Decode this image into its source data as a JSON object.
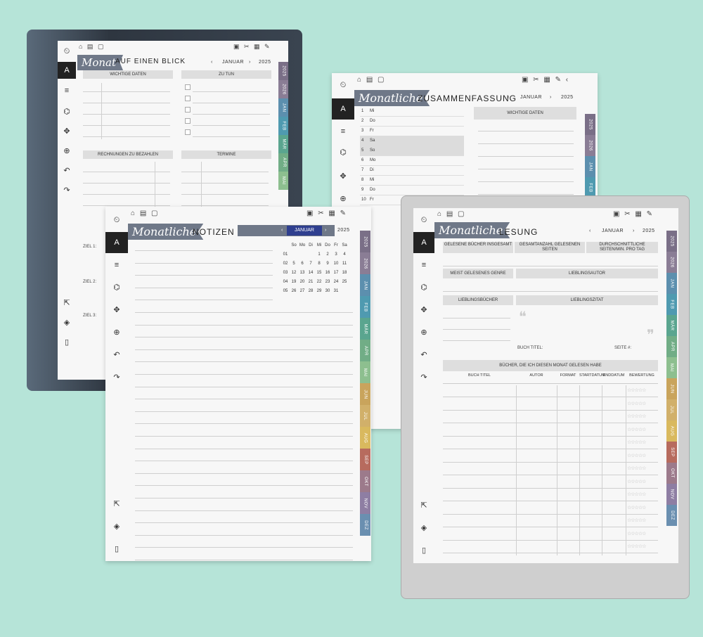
{
  "icons": {
    "home": "home-icon",
    "doc": "doc-icon",
    "page": "page-icon",
    "cal": "calendar-icon",
    "shuf": "shuffle-icon",
    "grid": "grid-icon",
    "clip": "clip-icon"
  },
  "toolbar": {
    "g1": "⏲",
    "g2": "A",
    "g3": "≡",
    "g4": "⌬",
    "g5": "✥",
    "g6": "⊕",
    "g7": "↶",
    "g8": "↷",
    "g9": "⇱",
    "g10": "◈",
    "g11": "▯"
  },
  "dev1": {
    "banner": "Monat",
    "title": "AUF EINEN BLICK",
    "month": "JANUAR",
    "year": "2025",
    "h1": "WICHTIGE DATEN",
    "h2": "ZU TUN",
    "h3": "RECHNUNGEN ZU BEZAHLEN",
    "h4": "TERMINE",
    "z1": "ZIEL 1:",
    "z2": "ZIEL 2:",
    "z3": "ZIEL 3:",
    "tabs": [
      "2025",
      "2026",
      "JAN",
      "FEB",
      "MÄR",
      "APR",
      "MAI"
    ]
  },
  "dev2": {
    "banner": "Monatliche",
    "title": "ZUSAMMENFASSUNG",
    "month": "JANUAR",
    "year": "2025",
    "hdr": "WICHTIGE DATEN",
    "days": [
      [
        "1",
        "Mi"
      ],
      [
        "2",
        "Do"
      ],
      [
        "3",
        "Fr"
      ],
      [
        "4",
        "Sa"
      ],
      [
        "5",
        "So"
      ],
      [
        "6",
        "Mo"
      ],
      [
        "7",
        "Di"
      ],
      [
        "8",
        "Mi"
      ],
      [
        "9",
        "Do"
      ],
      [
        "10",
        "Fr"
      ]
    ],
    "tabs": [
      "2025",
      "2026",
      "JAN",
      "FEB"
    ]
  },
  "dev3": {
    "banner": "Monatliche",
    "title": "NOTIZEN",
    "month": "JANUAR",
    "year": "2025",
    "wd": [
      "",
      "So",
      "Mo",
      "Di",
      "Mi",
      "Do",
      "Fr",
      "Sa"
    ],
    "weeks": [
      [
        "01",
        "",
        "",
        "",
        "1",
        "2",
        "3",
        "4"
      ],
      [
        "02",
        "5",
        "6",
        "7",
        "8",
        "9",
        "10",
        "11"
      ],
      [
        "03",
        "12",
        "13",
        "14",
        "15",
        "16",
        "17",
        "18"
      ],
      [
        "04",
        "19",
        "20",
        "21",
        "22",
        "23",
        "24",
        "25"
      ],
      [
        "05",
        "26",
        "27",
        "28",
        "29",
        "30",
        "31",
        ""
      ]
    ],
    "tabs": [
      "2025",
      "2026",
      "JAN",
      "FEB",
      "MÄR",
      "APR",
      "MAI",
      "JUN",
      "JUL",
      "AUG",
      "SEP",
      "OKT",
      "NOV",
      "DEZ"
    ]
  },
  "dev4": {
    "banner": "Monatliche",
    "title": "LESUNG",
    "month": "JANUAR",
    "year": "2025",
    "s1": "GELESENE BÜCHER INSGESAMT",
    "s2": "GESAMTANZAHL GELESENEN SEITEN",
    "s3": "DURCHSCHNITTLICHE SEITEN/MIN. PRO TAG",
    "genre": "MEIST GELESENES GENRE",
    "autor": "LIEBLINGSAUTOR",
    "books": "LIEBLINGSBÜCHER",
    "quote": "LIEBLINGSZITAT",
    "btitle": "BUCH TITEL:",
    "seite": "SEITE #:",
    "tblhdr": "BÜCHER, DIE ICH DIESEN MONAT GELESEN HABE",
    "cols": [
      "BUCH TITEL",
      "AUTOR",
      "FORMAT",
      "STARTDATUM",
      "ENDDATUM",
      "BEWERTUNG"
    ],
    "stars": "☆☆☆☆☆",
    "tabs": [
      "2025",
      "2026",
      "JAN",
      "FEB",
      "MÄR",
      "APR",
      "MAI",
      "JUN",
      "JUL",
      "AUG",
      "SEP",
      "OKT",
      "NOV",
      "DEZ"
    ]
  },
  "tabColors": {
    "2025": "#7a6f87",
    "2026": "#8a7d95",
    "JAN": "#5c8fae",
    "FEB": "#4f9ab0",
    "MÄR": "#5aa58f",
    "APR": "#71ad86",
    "MAI": "#8dbf8f",
    "JUN": "#c9a45c",
    "JUL": "#d1b06a",
    "AUG": "#d9b95e",
    "SEP": "#b76b5e",
    "OKT": "#9c7a8b",
    "NOV": "#8e7ea3",
    "DEZ": "#6a8fb0"
  }
}
